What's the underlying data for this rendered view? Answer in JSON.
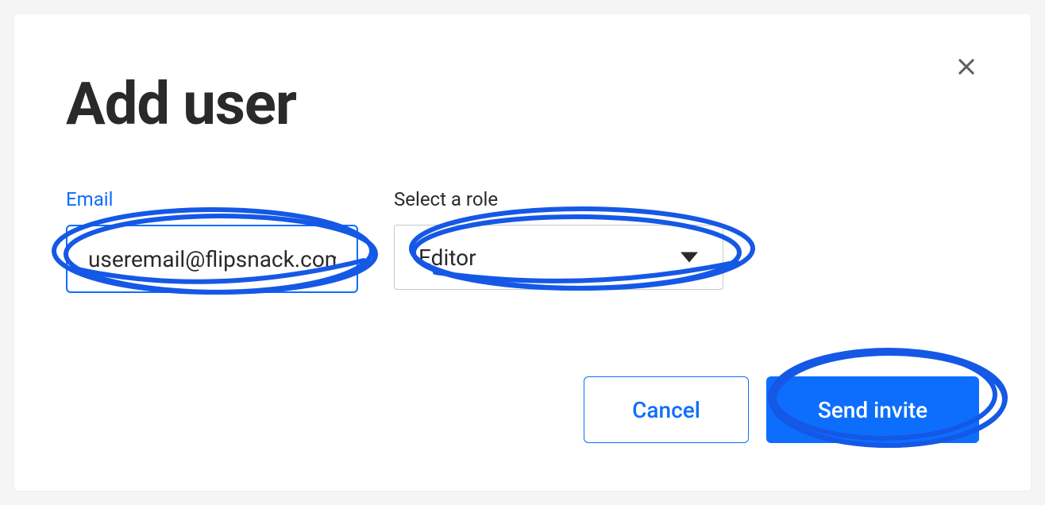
{
  "modal": {
    "title": "Add user",
    "close_aria": "Close"
  },
  "form": {
    "email": {
      "label": "Email",
      "value": "useremail@flipsnack.com"
    },
    "role": {
      "label": "Select a role",
      "selected": "Editor"
    }
  },
  "buttons": {
    "cancel": "Cancel",
    "send_invite": "Send invite"
  },
  "colors": {
    "accent": "#0d6efd",
    "text": "#2a2a2a"
  }
}
